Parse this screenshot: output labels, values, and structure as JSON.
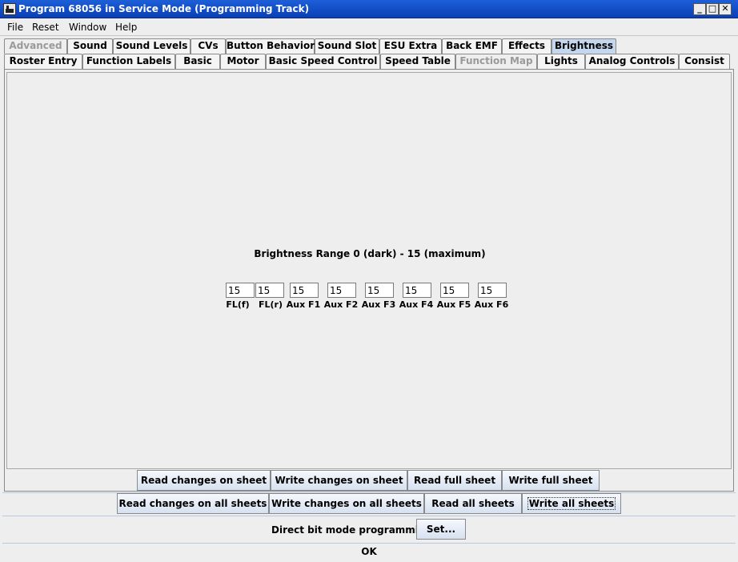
{
  "window": {
    "title": "Program 68056 in Service Mode (Programming Track)"
  },
  "menu": {
    "items": [
      "File",
      "Reset",
      "Window",
      "Help"
    ]
  },
  "tabs_row1": [
    {
      "label": "Advanced",
      "state": "disabled"
    },
    {
      "label": "Sound",
      "state": "normal"
    },
    {
      "label": "Sound Levels",
      "state": "normal"
    },
    {
      "label": "CVs",
      "state": "normal"
    },
    {
      "label": "Button Behavior",
      "state": "normal"
    },
    {
      "label": "Sound Slot",
      "state": "normal"
    },
    {
      "label": "ESU Extra",
      "state": "normal"
    },
    {
      "label": "Back EMF",
      "state": "normal"
    },
    {
      "label": "Effects",
      "state": "normal"
    },
    {
      "label": "Brightness",
      "state": "selected"
    }
  ],
  "tabs_row2": [
    {
      "label": "Roster Entry",
      "state": "normal"
    },
    {
      "label": "Function Labels",
      "state": "normal"
    },
    {
      "label": "Basic",
      "state": "normal"
    },
    {
      "label": "Motor",
      "state": "normal"
    },
    {
      "label": "Basic Speed Control",
      "state": "normal"
    },
    {
      "label": "Speed Table",
      "state": "normal"
    },
    {
      "label": "Function Map",
      "state": "disabled"
    },
    {
      "label": "Lights",
      "state": "normal"
    },
    {
      "label": "Analog Controls",
      "state": "normal"
    },
    {
      "label": "Consist",
      "state": "normal"
    }
  ],
  "panel": {
    "heading": "Brightness Range 0 (dark) - 15 (maximum)",
    "fields": [
      {
        "label": "FL(f)",
        "value": "15"
      },
      {
        "label": "FL(r)",
        "value": "15"
      },
      {
        "label": "Aux F1",
        "value": "15"
      },
      {
        "label": "Aux F2",
        "value": "15"
      },
      {
        "label": "Aux F3",
        "value": "15"
      },
      {
        "label": "Aux F4",
        "value": "15"
      },
      {
        "label": "Aux F5",
        "value": "15"
      },
      {
        "label": "Aux F6",
        "value": "15"
      }
    ]
  },
  "sheet_buttons": [
    "Read changes on sheet",
    "Write changes on sheet",
    "Read full sheet",
    "Write full sheet"
  ],
  "all_buttons": [
    "Read changes on all sheets",
    "Write changes on all sheets",
    "Read all sheets",
    "Write all sheets"
  ],
  "mode": {
    "label": "Direct bit mode programming",
    "button": "Set..."
  },
  "status": "OK"
}
